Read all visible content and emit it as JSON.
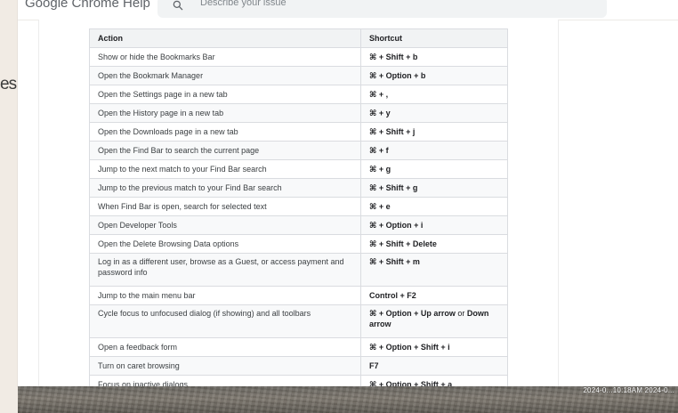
{
  "background_left_text": "es",
  "header": {
    "brand": "Google Chrome Help",
    "search_placeholder": "Describe your issue"
  },
  "table": {
    "columns": [
      "Action",
      "Shortcut"
    ],
    "rows": [
      {
        "action": "Show or hide the Bookmarks Bar",
        "shortcut": "⌘ + Shift + b"
      },
      {
        "action": "Open the Bookmark Manager",
        "shortcut": "⌘ + Option + b"
      },
      {
        "action": "Open the Settings page in a new tab",
        "shortcut": "⌘ + ,"
      },
      {
        "action": "Open the History page in a new tab",
        "shortcut": "⌘ + y"
      },
      {
        "action": "Open the Downloads page in a new tab",
        "shortcut": "⌘ + Shift + j"
      },
      {
        "action": "Open the Find Bar to search the current page",
        "shortcut": "⌘ + f"
      },
      {
        "action": "Jump to the next match to your Find Bar search",
        "shortcut": "⌘ + g"
      },
      {
        "action": "Jump to the previous match to your Find Bar search",
        "shortcut": "⌘ + Shift + g"
      },
      {
        "action": "When Find Bar is open, search for selected text",
        "shortcut": "⌘ + e"
      },
      {
        "action": "Open Developer Tools",
        "shortcut": "⌘ + Option + i"
      },
      {
        "action": "Open the Delete Browsing Data options",
        "shortcut": "⌘ + Shift + Delete"
      },
      {
        "action": "Log in as a different user, browse as a Guest, or access payment and password info",
        "shortcut": "⌘ + Shift + m"
      },
      {
        "action": "Jump to the main menu bar",
        "shortcut": "Control + F2"
      },
      {
        "action": "Cycle focus to unfocused dialog (if showing) and all toolbars",
        "shortcut_parts": [
          "⌘ + Option + Up arrow",
          " or ",
          "Down arrow"
        ]
      },
      {
        "action": "Open a feedback form",
        "shortcut": "⌘ + Option + Shift + i"
      },
      {
        "action": "Turn on caret browsing",
        "shortcut": "F7"
      },
      {
        "action": "Focus on inactive dialogs",
        "shortcut": "⌘ + Option + Shift + a"
      }
    ]
  },
  "footer": {
    "timestamp": "2024-0...10:18AM  2024-0..."
  },
  "colors": {
    "background": "#f1ebe4",
    "header_row": "#f1f3f4",
    "zebra_row": "#f8f9fa",
    "border": "#dadce0"
  }
}
